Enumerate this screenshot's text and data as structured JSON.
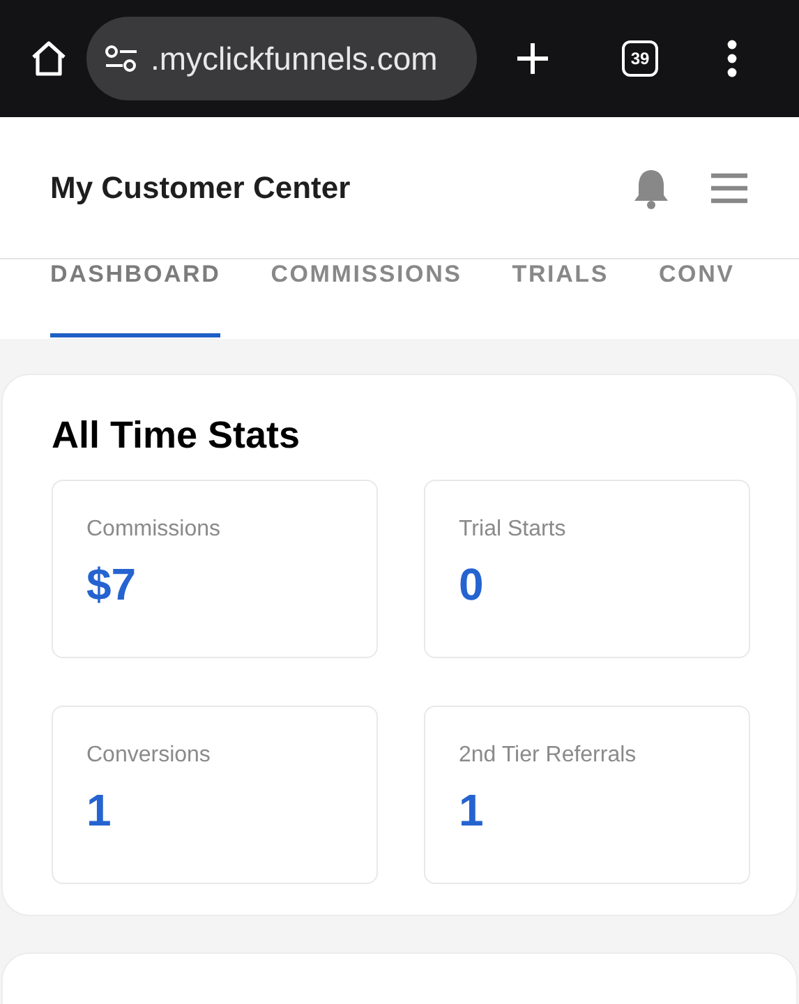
{
  "browser": {
    "url": ".myclickfunnels.com",
    "tab_count": "39"
  },
  "header": {
    "title": "My Customer Center"
  },
  "tabs": [
    {
      "label": "DASHBOARD",
      "selected": true
    },
    {
      "label": "COMMISSIONS",
      "selected": false
    },
    {
      "label": "TRIALS",
      "selected": false
    },
    {
      "label": "CONV",
      "selected": false
    }
  ],
  "stats_card": {
    "title": "All Time Stats",
    "stats": [
      {
        "label": "Commissions",
        "value": "$7"
      },
      {
        "label": "Trial Starts",
        "value": "0"
      },
      {
        "label": "Conversions",
        "value": "1"
      },
      {
        "label": "2nd Tier Referrals",
        "value": "1"
      }
    ]
  }
}
